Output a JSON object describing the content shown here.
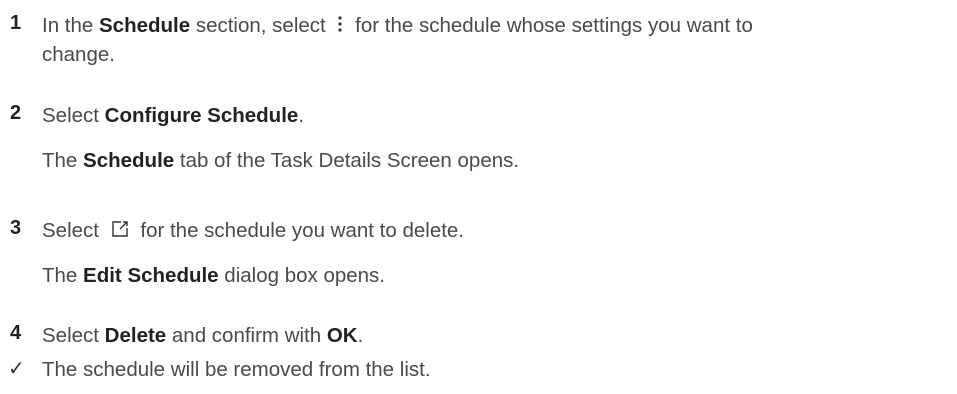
{
  "steps": [
    {
      "number": "1",
      "t1": "In the ",
      "b1": "Schedule",
      "t2": " section, select ",
      "icon": "more-vertical-icon",
      "t3": " for the schedule whose settings you want to",
      "t4": "change."
    },
    {
      "number": "2",
      "t1": "Select ",
      "b1": "Configure Schedule",
      "t2": ".",
      "result": {
        "t1": "The ",
        "b1": "Schedule",
        "t2": " tab of the Task Details Screen opens."
      }
    },
    {
      "number": "3",
      "t1": "Select ",
      "icon": "edit-icon",
      "t2": " for the schedule you want to delete.",
      "result": {
        "t1": "The ",
        "b1": "Edit Schedule",
        "t2": " dialog box opens."
      }
    },
    {
      "number": "4",
      "t1": "Select ",
      "b1": "Delete",
      "t2": " and confirm with ",
      "b2": "OK",
      "t3": "."
    }
  ],
  "outcome": {
    "mark": "✓",
    "text": "The schedule will be removed from the list."
  }
}
